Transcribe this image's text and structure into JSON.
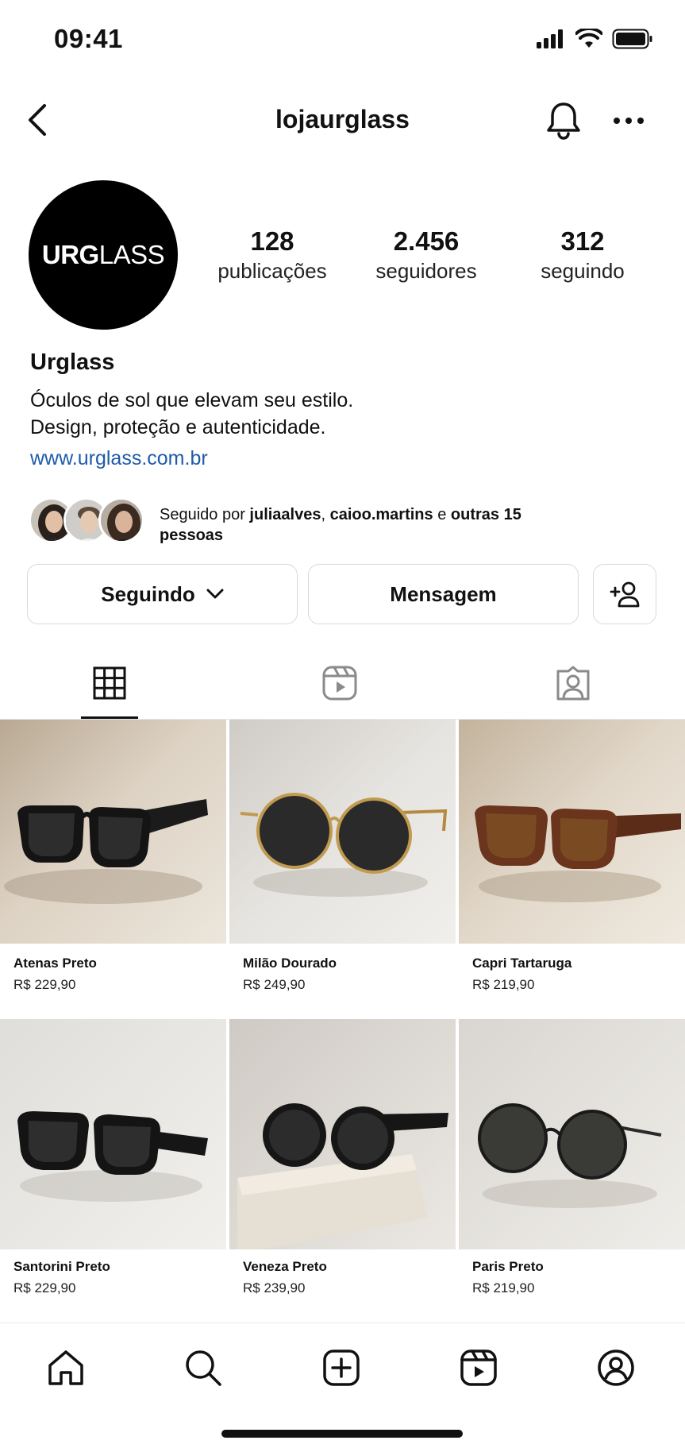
{
  "status_bar": {
    "time": "09:41"
  },
  "header": {
    "username": "lojaurglass"
  },
  "profile": {
    "avatar_text_bold": "URG",
    "avatar_text_light": "LASS",
    "stats": {
      "posts_count": "128",
      "posts_label": "publicações",
      "followers_count": "2.456",
      "followers_label": "seguidores",
      "following_count": "312",
      "following_label": "seguindo"
    },
    "name": "Urglass",
    "bio_line1": "Óculos de sol que elevam seu estilo.",
    "bio_line2": "Design, proteção e autenticidade.",
    "website": "www.urglass.com.br",
    "followed_by": {
      "prefix": "Seguido por ",
      "user1": "juliaalves",
      "separator": ", ",
      "user2": "caioo.martins",
      "conjunction": " e ",
      "others": "outras 15",
      "suffix": "pessoas"
    }
  },
  "actions": {
    "following_label": "Seguindo",
    "message_label": "Mensagem"
  },
  "products": [
    {
      "name": "Atenas Preto",
      "price": "R$ 229,90"
    },
    {
      "name": "Milão Dourado",
      "price": "R$ 249,90"
    },
    {
      "name": "Capri Tartaruga",
      "price": "R$ 219,90"
    },
    {
      "name": "Santorini Preto",
      "price": "R$ 229,90"
    },
    {
      "name": "Veneza Preto",
      "price": "R$ 239,90"
    },
    {
      "name": "Paris Preto",
      "price": "R$ 219,90"
    }
  ],
  "colors": {
    "link": "#1e5ba8",
    "text": "#111111",
    "border": "#d9d9d9"
  },
  "icons": {
    "status": [
      "signal-icon",
      "wifi-icon",
      "battery-icon"
    ],
    "header": [
      "back-arrow-icon",
      "bell-icon",
      "more-icon"
    ],
    "tabs": [
      "grid-icon",
      "reels-icon",
      "tagged-icon"
    ],
    "nav": [
      "home-icon",
      "search-icon",
      "create-icon",
      "reels-icon",
      "profile-icon"
    ]
  }
}
